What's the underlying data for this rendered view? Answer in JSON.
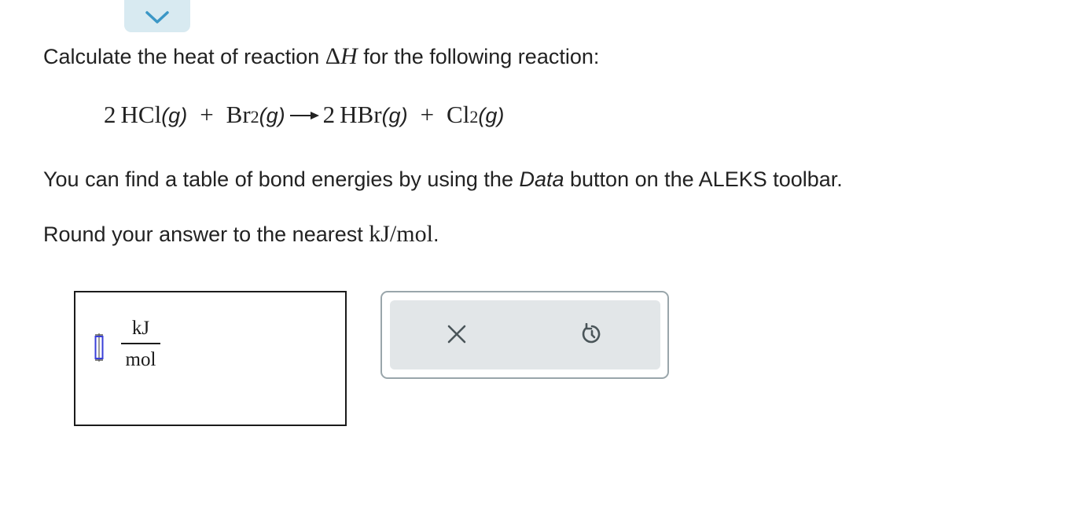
{
  "collapse": {
    "icon": "chevron-down-icon",
    "color": "#3b97c6"
  },
  "prompt": {
    "intro_before": "Calculate the heat of reaction ",
    "delta_symbol": "Δ",
    "h_symbol": "H",
    "intro_after": " for the following reaction:",
    "bond_table_before": "You can find a table of bond energies by using the ",
    "bond_table_emphasis": "Data",
    "bond_table_after": " button on the ALEKS toolbar.",
    "round_before": "Round your answer to the nearest ",
    "round_unit": "kJ/mol",
    "round_after": "."
  },
  "equation": {
    "reactant1_coef": "2",
    "reactant1": "HCl",
    "reactant1_state": "(g)",
    "plus1": "+",
    "reactant2": "Br",
    "reactant2_sub": "2",
    "reactant2_state": "(g)",
    "product1_coef": "2",
    "product1": "HBr",
    "product1_state": "(g)",
    "plus2": "+",
    "product2": "Cl",
    "product2_sub": "2",
    "product2_state": "(g)"
  },
  "answer": {
    "value": "",
    "unit_numerator": "kJ",
    "unit_denominator": "mol",
    "cursor_color": "#3a3fd8"
  },
  "toolbar": {
    "clear_icon": "close-icon",
    "undo_icon": "undo-icon",
    "icon_color": "#4a5559"
  }
}
